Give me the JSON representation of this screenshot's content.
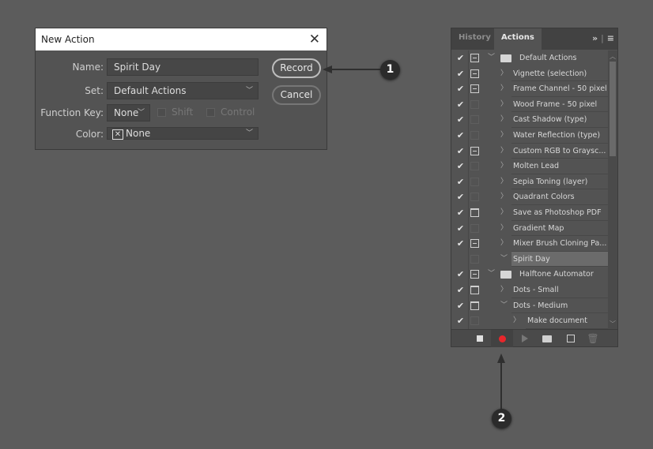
{
  "dialog": {
    "title": "New Action",
    "name_label": "Name:",
    "name_value": "Spirit Day",
    "set_label": "Set:",
    "set_value": "Default Actions",
    "function_key_label": "Function Key:",
    "function_key_value": "None",
    "shift_label": "Shift",
    "control_label": "Control",
    "color_label": "Color:",
    "color_value": "None",
    "record_label": "Record",
    "cancel_label": "Cancel"
  },
  "panel": {
    "tabs": [
      {
        "label": "History",
        "active": false
      },
      {
        "label": "Actions",
        "active": true
      }
    ],
    "rows": [
      {
        "label": "Default Actions",
        "checked": true,
        "dialog": "modal",
        "kind": "set",
        "expanded": true
      },
      {
        "label": "Vignette (selection)",
        "checked": true,
        "dialog": "modal",
        "kind": "action",
        "expanded": false
      },
      {
        "label": "Frame Channel - 50 pixel",
        "checked": true,
        "dialog": "modal",
        "kind": "action",
        "expanded": false
      },
      {
        "label": "Wood Frame - 50 pixel",
        "checked": true,
        "dialog": "none",
        "kind": "action",
        "expanded": false
      },
      {
        "label": "Cast Shadow (type)",
        "checked": true,
        "dialog": "none",
        "kind": "action",
        "expanded": false
      },
      {
        "label": "Water Reflection (type)",
        "checked": true,
        "dialog": "none",
        "kind": "action",
        "expanded": false
      },
      {
        "label": "Custom RGB to Graysc...",
        "checked": true,
        "dialog": "modal",
        "kind": "action",
        "expanded": false
      },
      {
        "label": "Molten Lead",
        "checked": true,
        "dialog": "none",
        "kind": "action",
        "expanded": false
      },
      {
        "label": "Sepia Toning (layer)",
        "checked": true,
        "dialog": "none",
        "kind": "action",
        "expanded": false
      },
      {
        "label": "Quadrant Colors",
        "checked": true,
        "dialog": "none",
        "kind": "action",
        "expanded": false
      },
      {
        "label": "Save as Photoshop PDF",
        "checked": true,
        "dialog": "dialog",
        "kind": "action",
        "expanded": false
      },
      {
        "label": "Gradient Map",
        "checked": true,
        "dialog": "none",
        "kind": "action",
        "expanded": false
      },
      {
        "label": "Mixer Brush Cloning Pa...",
        "checked": true,
        "dialog": "modal",
        "kind": "action",
        "expanded": false
      },
      {
        "label": "Spirit Day",
        "checked": false,
        "dialog": "none",
        "kind": "action",
        "expanded": true,
        "selected": true
      },
      {
        "label": "Halftone Automator",
        "checked": true,
        "dialog": "modal",
        "kind": "set",
        "expanded": true
      },
      {
        "label": "Dots - Small",
        "checked": true,
        "dialog": "dialog",
        "kind": "action",
        "expanded": false
      },
      {
        "label": "Dots - Medium",
        "checked": true,
        "dialog": "dialog",
        "kind": "action",
        "expanded": true
      },
      {
        "label": "Make document",
        "checked": true,
        "dialog": "none",
        "kind": "command",
        "expanded": false
      }
    ],
    "footer_buttons": [
      "stop-icon",
      "record-icon",
      "play-icon",
      "folder-icon",
      "new-action-icon",
      "trash-icon"
    ],
    "record_color": "#e8262b"
  },
  "callouts": [
    "1",
    "2"
  ]
}
